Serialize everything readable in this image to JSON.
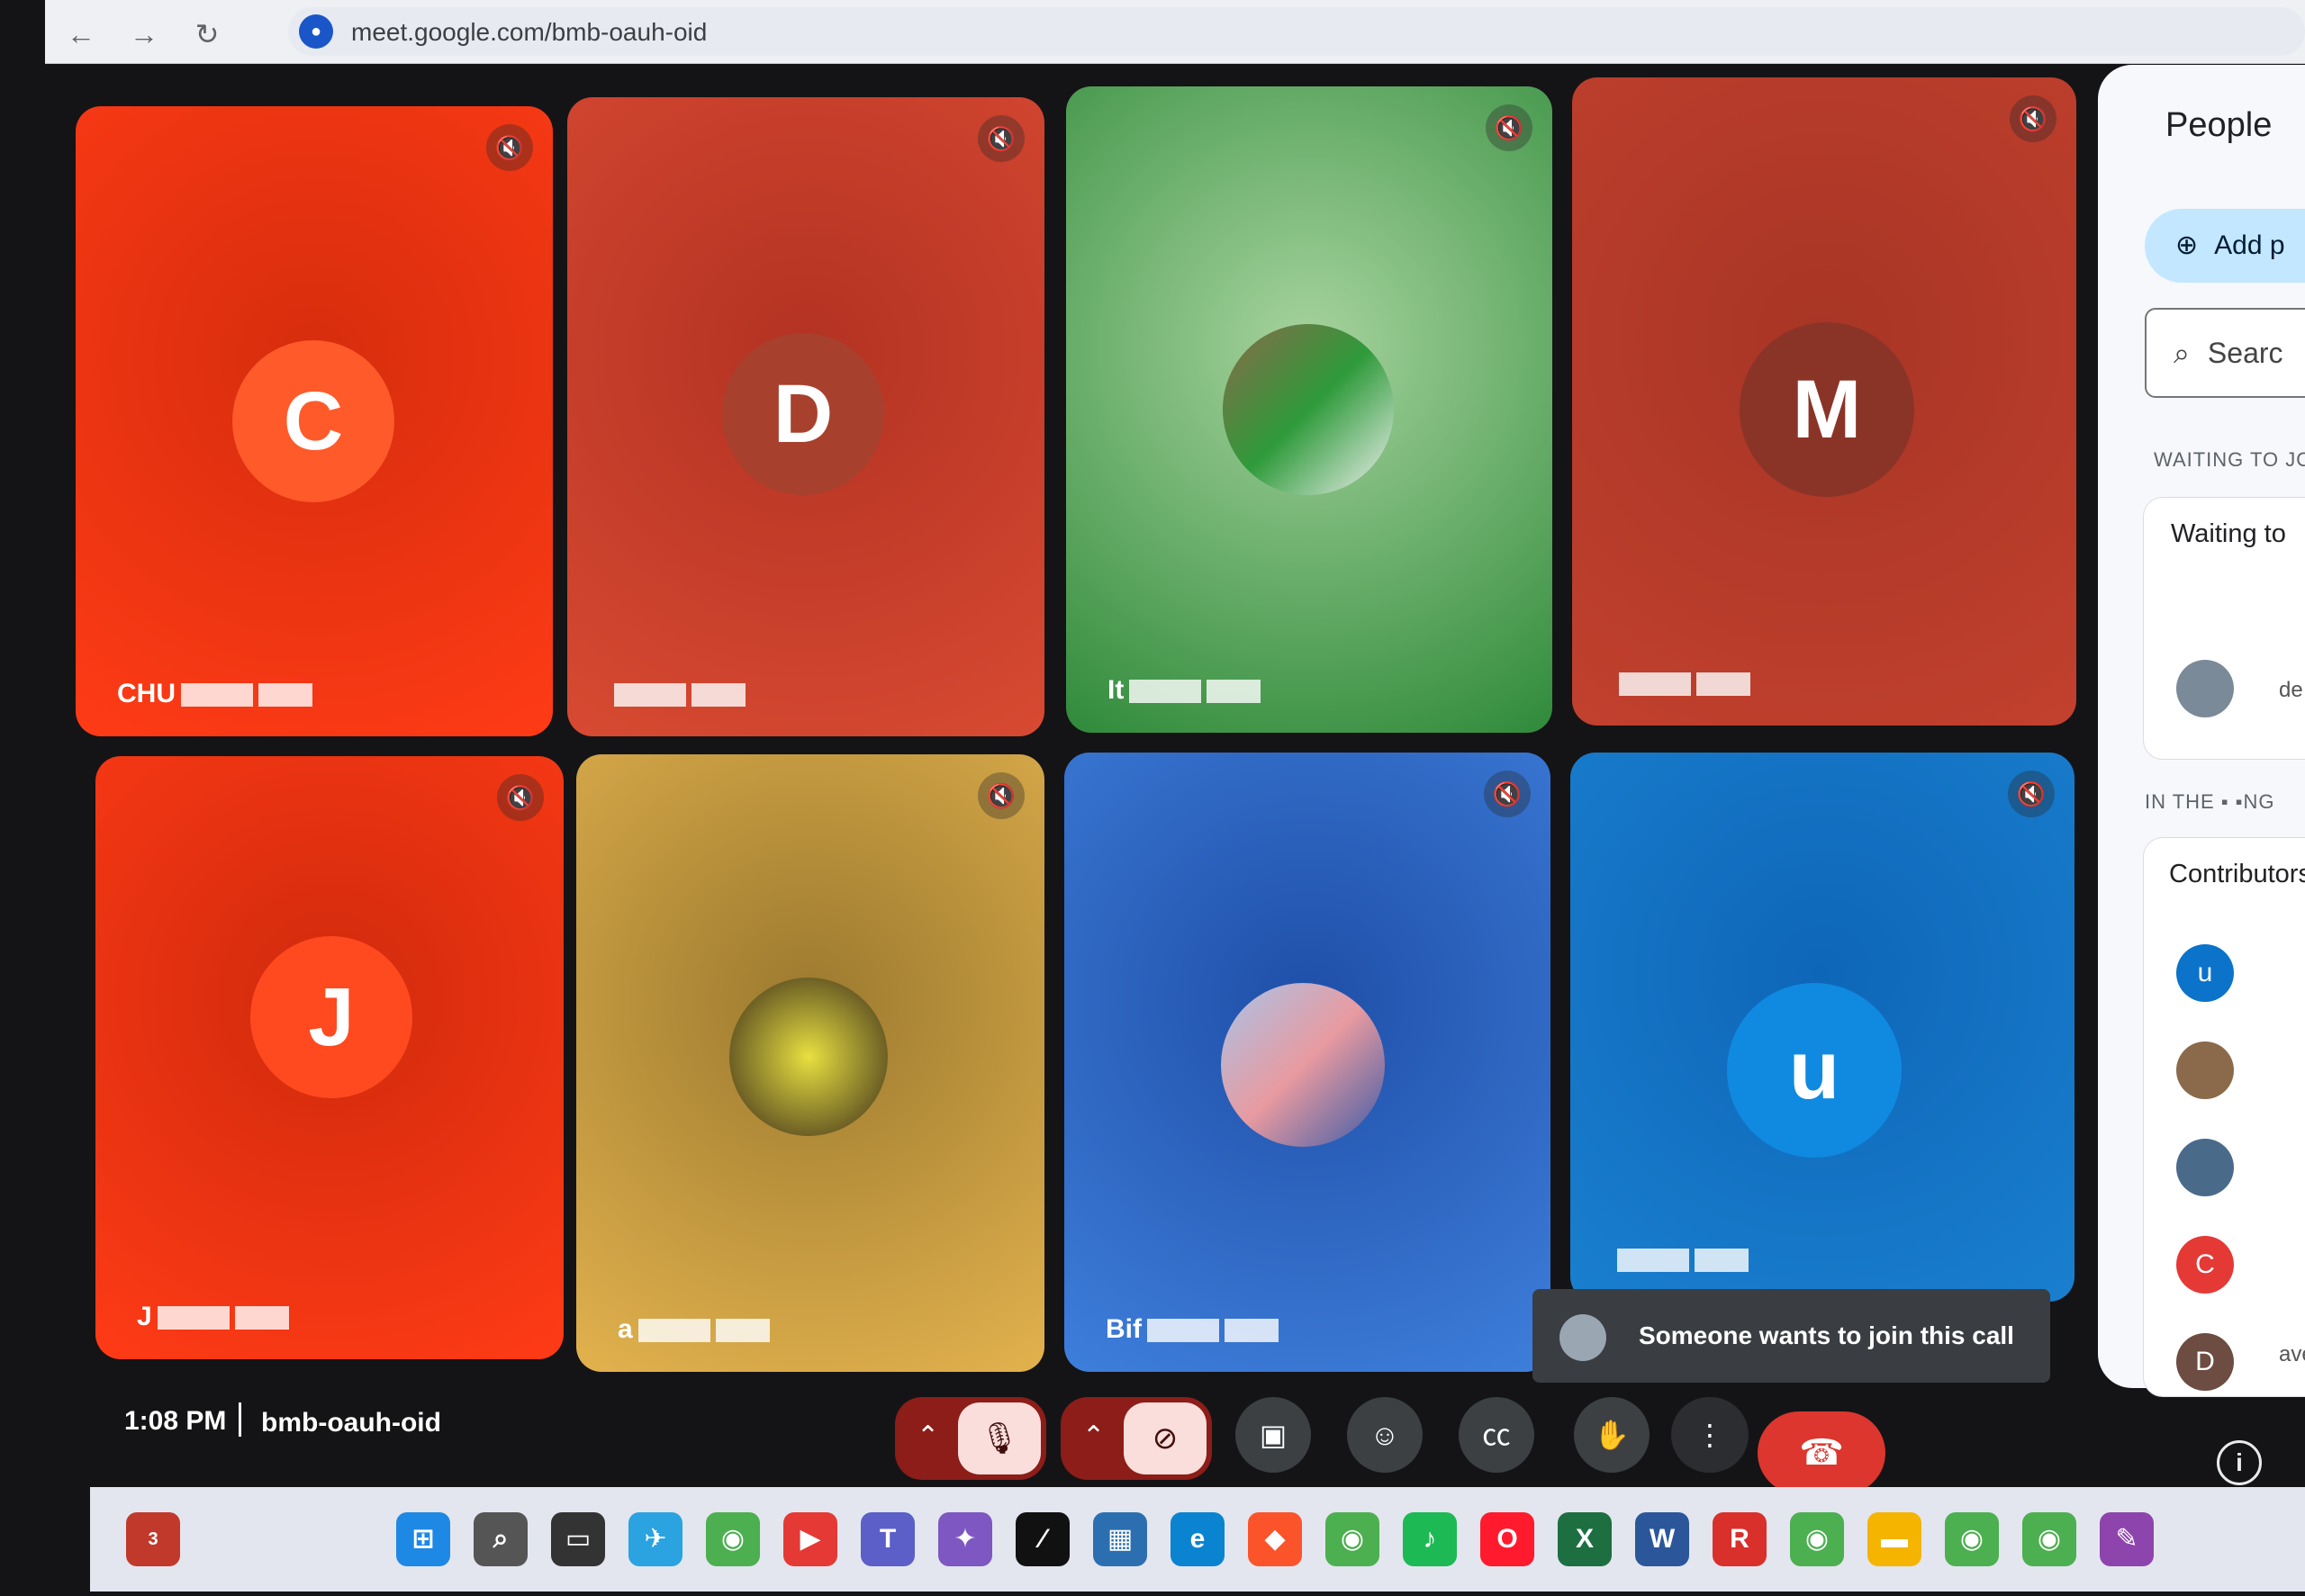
{
  "browser": {
    "back_glyph": "←",
    "forward_glyph": "→",
    "reload_glyph": "↻",
    "url": "meet.google.com/bmb-oauh-oid",
    "mic_icon": "mic-icon"
  },
  "tiles": [
    {
      "initial": "C",
      "name": "CHU",
      "bg_from": "#ff3b16",
      "bg_to": "#d62d0d",
      "avatar_color": "#ff5a2a"
    },
    {
      "initial": "D",
      "name": "",
      "bg_from": "#d84a32",
      "bg_to": "#b33222",
      "avatar_color": "#a8402e"
    },
    {
      "initial": "",
      "name": "It",
      "bg_from": "#2f8a3a",
      "bg_to": "#a6d39d",
      "avatar_color": ""
    },
    {
      "initial": "M",
      "name": "",
      "bg_from": "#c2402e",
      "bg_to": "#a83525",
      "avatar_color": "#8a3428"
    },
    {
      "initial": "J",
      "name": "J",
      "bg_from": "#ff3b16",
      "bg_to": "#d02a0d",
      "avatar_color": "#ff4a20"
    },
    {
      "initial": "",
      "name": "a",
      "bg_from": "#e3b24e",
      "bg_to": "#9c7a2f",
      "avatar_color": ""
    },
    {
      "initial": "",
      "name": "Bif",
      "bg_from": "#3e7fdc",
      "bg_to": "#1f4fa8",
      "avatar_color": ""
    },
    {
      "initial": "u",
      "name": "",
      "bg_from": "#1a7fcf",
      "bg_to": "#0e66b8",
      "avatar_color": "#0f8ae0"
    }
  ],
  "panel": {
    "title": "People",
    "add_label": "Add p",
    "search_placeholder": "Searc",
    "waiting_section": "WAITING TO JO",
    "waiting_card_title": "Waiting to",
    "waiting_person_suffix": "de",
    "in_call_section": "IN THE",
    "in_call_section_end": "NG",
    "contributors_title": "Contributors",
    "contributors": [
      {
        "initial": "u",
        "color": "#0b73c9"
      },
      {
        "initial": "",
        "color": "#8a6a4a"
      },
      {
        "initial": "",
        "color": "#4a6a8a"
      },
      {
        "initial": "C",
        "color": "#e53935"
      },
      {
        "initial": "D",
        "color": "#6d4c41"
      }
    ],
    "last_text": "ave"
  },
  "toast": {
    "text": "Someone wants to join this call"
  },
  "meeting": {
    "time": "1:08 PM",
    "code": "bmb-oauh-oid"
  },
  "controls": {
    "mic_off": "mic-off-icon",
    "cam_off": "camera-off-icon",
    "present": "present-icon",
    "emoji": "emoji-icon",
    "captions": "captions-icon",
    "hand": "raise-hand-icon",
    "more": "more-options-icon",
    "end": "end-call-icon",
    "info": "i"
  },
  "taskbar": {
    "notification_badge": "3",
    "icons": [
      "windows-start-icon",
      "search-icon",
      "task-view-icon",
      "telegram-icon",
      "chrome-icon",
      "youtube-icon",
      "teams-icon",
      "copilot-icon",
      "capcut-icon",
      "store-icon",
      "edge-icon",
      "brave-icon",
      "chrome-icon",
      "spotify-icon",
      "opera-icon",
      "excel-icon",
      "word-icon",
      "reader-icon",
      "chrome-icon",
      "folder-icon",
      "chrome-icon",
      "chrome-icon",
      "app-icon"
    ]
  }
}
